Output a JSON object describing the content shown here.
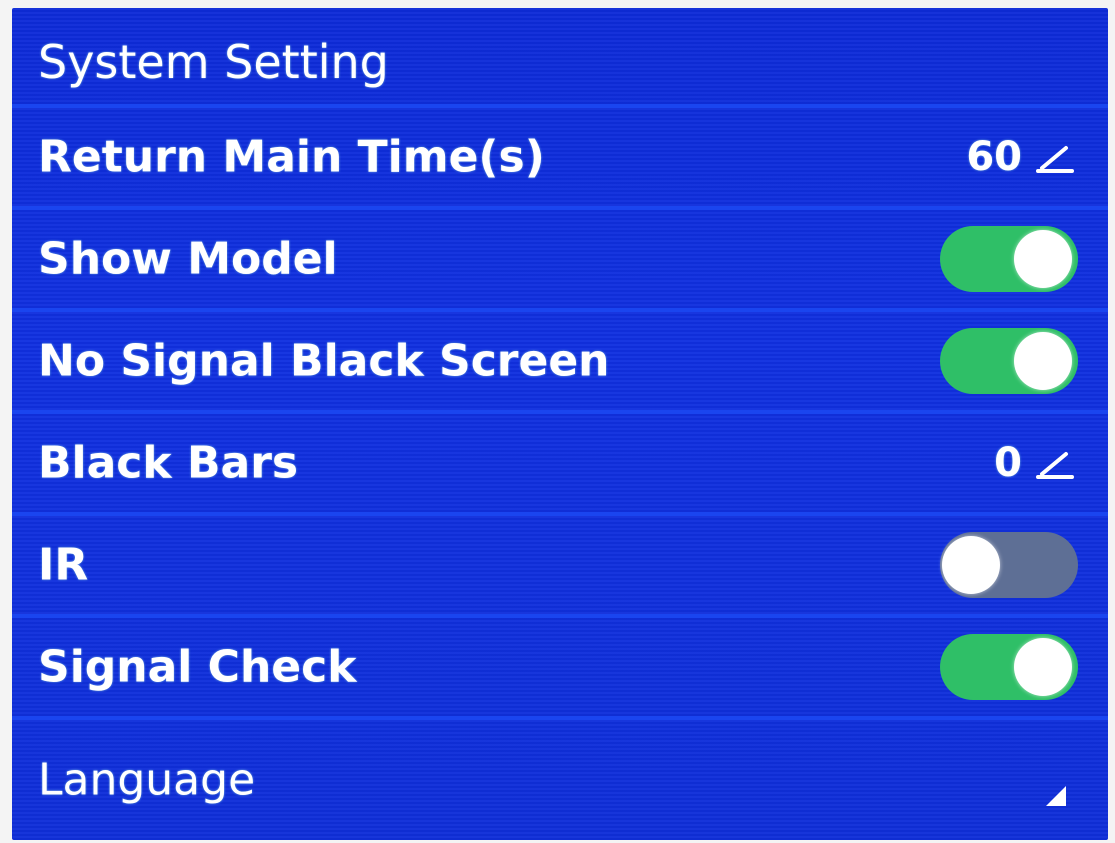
{
  "header": {
    "title": "System Setting"
  },
  "settings": {
    "return_main_time": {
      "label": "Return Main Time(s)",
      "value": "60",
      "icon": "edit-icon"
    },
    "show_model": {
      "label": "Show Model",
      "enabled": true,
      "icon": "toggle-switch"
    },
    "no_signal_black_screen": {
      "label": "No Signal Black Screen",
      "enabled": true,
      "icon": "toggle-switch"
    },
    "black_bars": {
      "label": "Black Bars",
      "value": "0",
      "icon": "edit-icon"
    },
    "ir": {
      "label": "IR",
      "enabled": false,
      "icon": "toggle-switch"
    },
    "signal_check": {
      "label": "Signal Check",
      "enabled": true,
      "icon": "toggle-switch"
    },
    "language": {
      "label": "Language",
      "icon": "dropdown-triangle-icon"
    }
  },
  "colors": {
    "background": "#1030e0",
    "divider": "#1a45ef",
    "toggle_on": "#2fbf67",
    "toggle_off": "#5e6f95",
    "text": "#ffffff"
  }
}
